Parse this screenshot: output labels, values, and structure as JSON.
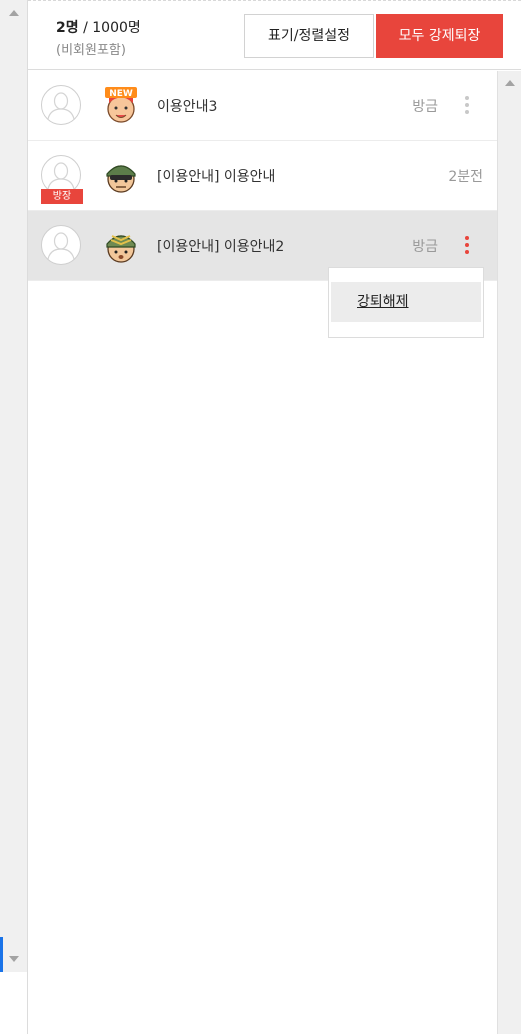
{
  "header": {
    "count_current": "2명",
    "count_separator": " / ",
    "count_max": "1000명",
    "count_sub": "(비회원포함)",
    "sort_button": "표기/정렬설정",
    "kick_all_button": "모두 강제퇴장"
  },
  "users": [
    {
      "name": "이용안내3",
      "status": "방금",
      "character": "new-character-icon",
      "host": false
    },
    {
      "name": "[이용안내] 이용안내",
      "status": "2분전",
      "character": "soldier-character-icon",
      "host": true,
      "host_badge": "방장"
    },
    {
      "name": "[이용안내] 이용안내2",
      "status": "방금",
      "character": "sergeant-character-icon",
      "host": false
    }
  ],
  "menu": {
    "item": "강퇴해제"
  },
  "colors": {
    "accent": "#e8453c",
    "active_row": "#e5e5e5"
  }
}
